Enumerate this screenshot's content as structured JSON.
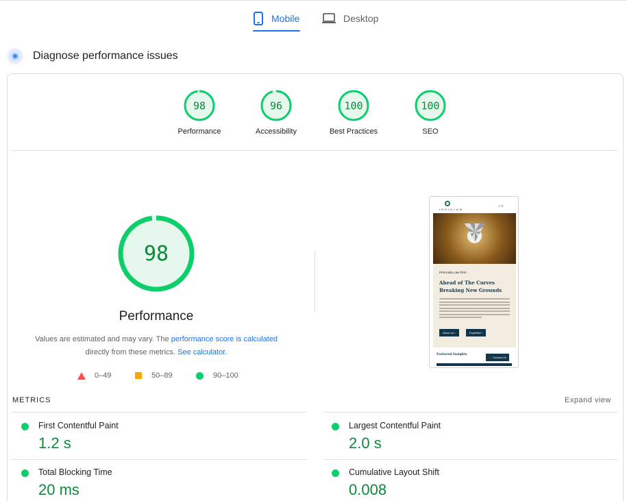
{
  "tabs": [
    {
      "label": "Mobile",
      "icon": "mobile-icon",
      "active": true
    },
    {
      "label": "Desktop",
      "icon": "desktop-icon",
      "active": false
    }
  ],
  "diagnose": {
    "title": "Diagnose performance issues"
  },
  "colors": {
    "pass": "#0cce6b",
    "pass_text": "#0a8a3a",
    "average": "#ffa400",
    "fail": "#ff4e42",
    "accent": "#1a73e8"
  },
  "scores": [
    {
      "value": 98,
      "label": "Performance"
    },
    {
      "value": 96,
      "label": "Accessibility"
    },
    {
      "value": 100,
      "label": "Best Practices"
    },
    {
      "value": 100,
      "label": "SEO"
    }
  ],
  "main_score": {
    "value": 98,
    "label": "Performance",
    "note_prefix": "Values are estimated and may vary. The ",
    "note_link1": "performance score is calculated",
    "note_middle": " directly from these metrics. ",
    "note_link2": "See calculator."
  },
  "legend": [
    {
      "range": "0–49",
      "shape": "triangle"
    },
    {
      "range": "50–89",
      "shape": "square"
    },
    {
      "range": "90–100",
      "shape": "circle"
    }
  ],
  "preview": {
    "brand": "INDIALAW",
    "eyebrow": "PAN India Law Firm",
    "headline_1": "Ahead of The Curves",
    "headline_2": "Breaking New Grounds",
    "button_1": "About Us ›",
    "button_2": "Expertise ›",
    "featured": "Featured Insights",
    "contact": "📞 Contact Us"
  },
  "metrics": {
    "label": "METRICS",
    "expand": "Expand view",
    "items": [
      {
        "name": "First Contentful Paint",
        "value": "1.2 s"
      },
      {
        "name": "Largest Contentful Paint",
        "value": "2.0 s"
      },
      {
        "name": "Total Blocking Time",
        "value": "20 ms"
      },
      {
        "name": "Cumulative Layout Shift",
        "value": "0.008"
      }
    ]
  }
}
